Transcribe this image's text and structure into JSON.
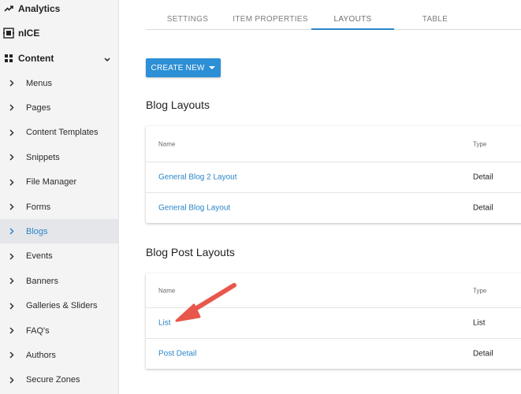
{
  "sidebar": {
    "top": [
      {
        "label": "Analytics",
        "icon": "trending-up-icon"
      },
      {
        "label": "nICE",
        "icon": "nice-logo-icon"
      },
      {
        "label": "Content",
        "icon": "grid-icon"
      }
    ],
    "items": [
      {
        "label": "Menus"
      },
      {
        "label": "Pages"
      },
      {
        "label": "Content Templates"
      },
      {
        "label": "Snippets"
      },
      {
        "label": "File Manager"
      },
      {
        "label": "Forms"
      },
      {
        "label": "Blogs"
      },
      {
        "label": "Events"
      },
      {
        "label": "Banners"
      },
      {
        "label": "Galleries & Sliders"
      },
      {
        "label": "FAQ's"
      },
      {
        "label": "Authors"
      },
      {
        "label": "Secure Zones"
      }
    ],
    "active_item": "Blogs"
  },
  "tabs": [
    {
      "label": "SETTINGS"
    },
    {
      "label": "ITEM PROPERTIES"
    },
    {
      "label": "LAYOUTS"
    },
    {
      "label": "TABLE"
    }
  ],
  "active_tab": "LAYOUTS",
  "create_button": {
    "label": "CREATE NEW"
  },
  "blog_layouts": {
    "title": "Blog Layouts",
    "columns": {
      "name": "Name",
      "type": "Type"
    },
    "rows": [
      {
        "name": "General Blog 2 Layout",
        "type": "Detail"
      },
      {
        "name": "General Blog Layout",
        "type": "Detail"
      }
    ]
  },
  "blog_post_layouts": {
    "title": "Blog Post Layouts",
    "columns": {
      "name": "Name",
      "type": "Type"
    },
    "rows": [
      {
        "name": "List",
        "type": "List"
      },
      {
        "name": "Post Detail",
        "type": "Detail"
      }
    ]
  },
  "colors": {
    "accent": "#2a86c9",
    "button": "#2d8fd5",
    "annotation_arrow": "#e8574b"
  }
}
